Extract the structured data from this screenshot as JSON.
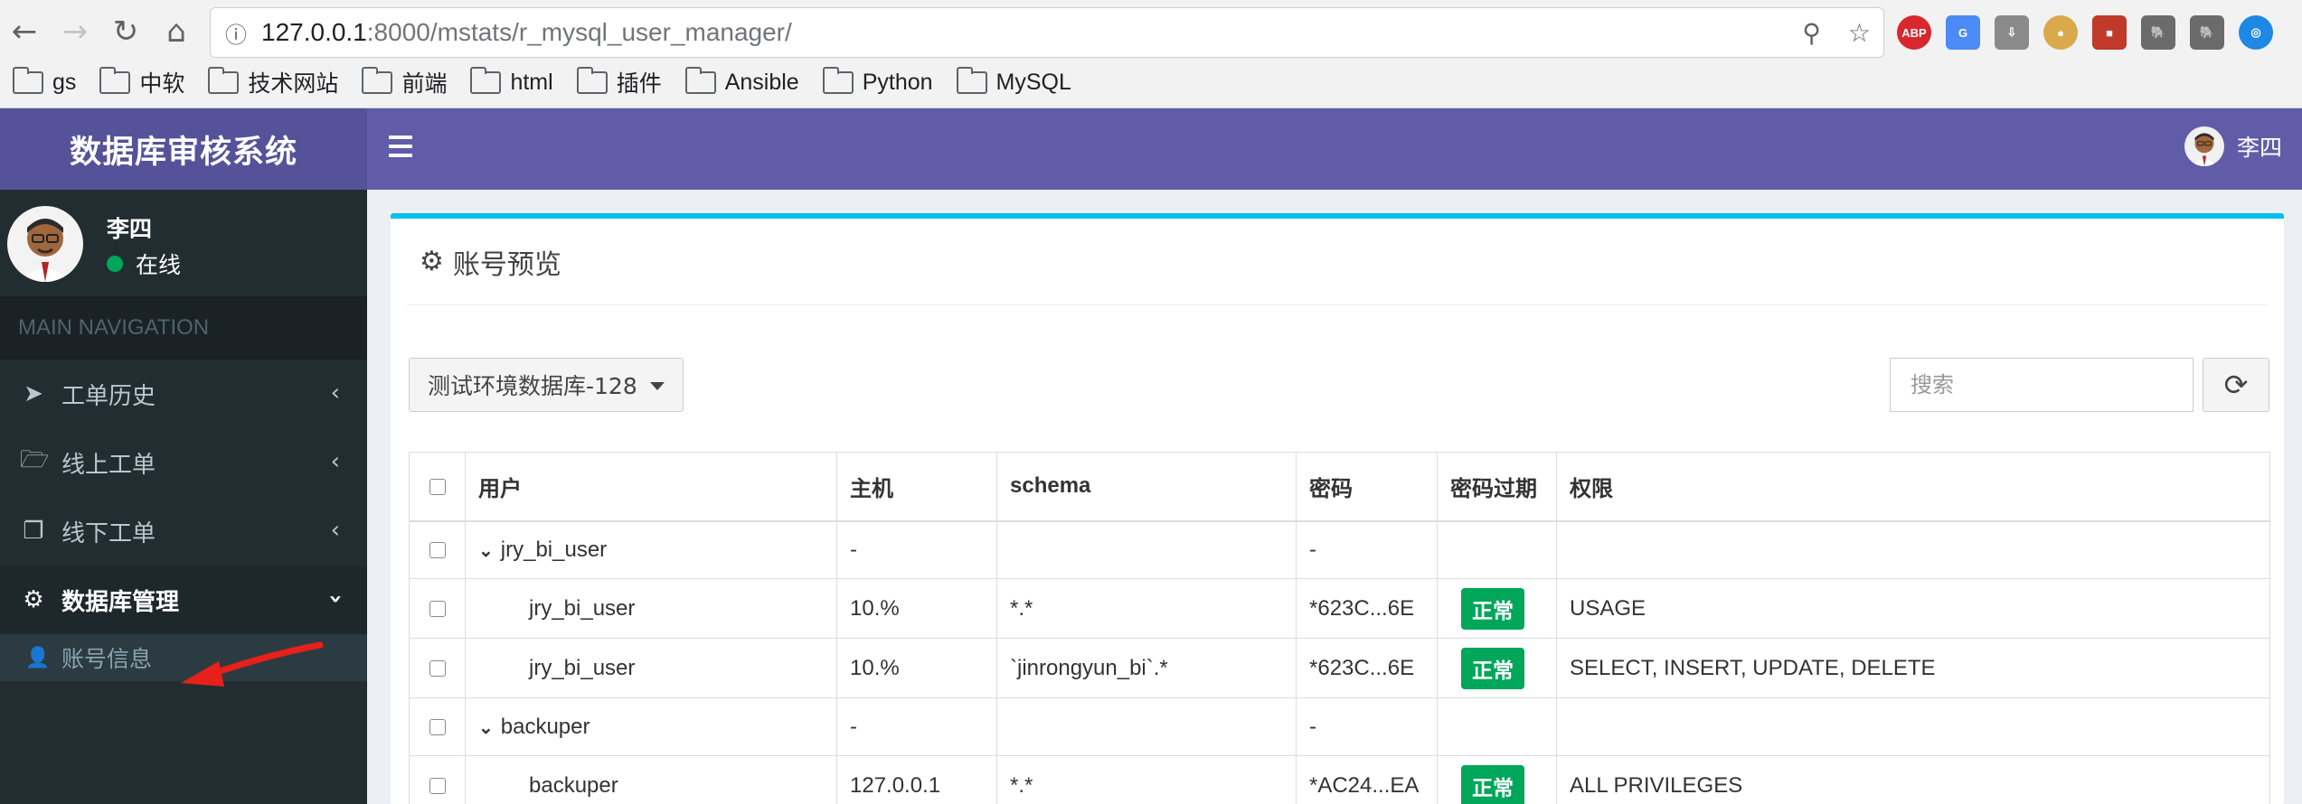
{
  "browser": {
    "url_host": "127.0.0.1",
    "url_rest": ":8000/mstats/r_mysql_user_manager/",
    "bookmarks": [
      "gs",
      "中软",
      "技术网站",
      "前端",
      "html",
      "插件",
      "Ansible",
      "Python",
      "MySQL"
    ],
    "extensions": [
      "ABP",
      "G",
      "⇩",
      "●",
      "■",
      "🐘",
      "◎"
    ]
  },
  "app": {
    "logo": "数据库审核系统",
    "top_user": "李四"
  },
  "sidebar": {
    "user_name": "李四",
    "status": "在线",
    "nav_header": "MAIN NAVIGATION",
    "items": [
      {
        "label": "工单历史",
        "icon": "paper-plane-icon"
      },
      {
        "label": "线上工单",
        "icon": "folder-open-icon"
      },
      {
        "label": "线下工单",
        "icon": "copy-icon"
      },
      {
        "label": "数据库管理",
        "icon": "gear-icon"
      }
    ],
    "sub_items": [
      {
        "label": "账号信息",
        "icon": "user-icon"
      }
    ]
  },
  "box": {
    "title": "账号预览",
    "db_select": "测试环境数据库-128",
    "search_placeholder": "搜索"
  },
  "table": {
    "headers": [
      "用户",
      "主机",
      "schema",
      "密码",
      "密码过期",
      "权限"
    ],
    "rows": [
      {
        "type": "group",
        "user": "jry_bi_user",
        "host": "-",
        "schema": "",
        "password": "-",
        "expired": "",
        "privs": ""
      },
      {
        "type": "child",
        "user": "jry_bi_user",
        "host": "10.%",
        "schema": "*.*",
        "password": "*623C...6E",
        "expired": "正常",
        "privs": "USAGE"
      },
      {
        "type": "child",
        "user": "jry_bi_user",
        "host": "10.%",
        "schema": "`jinrongyun_bi`.*",
        "password": "*623C...6E",
        "expired": "正常",
        "privs": "SELECT, INSERT, UPDATE, DELETE"
      },
      {
        "type": "group",
        "user": "backuper",
        "host": "-",
        "schema": "",
        "password": "-",
        "expired": "",
        "privs": ""
      },
      {
        "type": "child",
        "user": "backuper",
        "host": "127.0.0.1",
        "schema": "*.*",
        "password": "*AC24...EA",
        "expired": "正常",
        "privs": "ALL PRIVILEGES"
      }
    ]
  },
  "colors": {
    "header": "#605ca8",
    "logo": "#555299",
    "sidebar": "#222d32",
    "box_accent": "#00c0ef",
    "badge": "#00a65a"
  }
}
